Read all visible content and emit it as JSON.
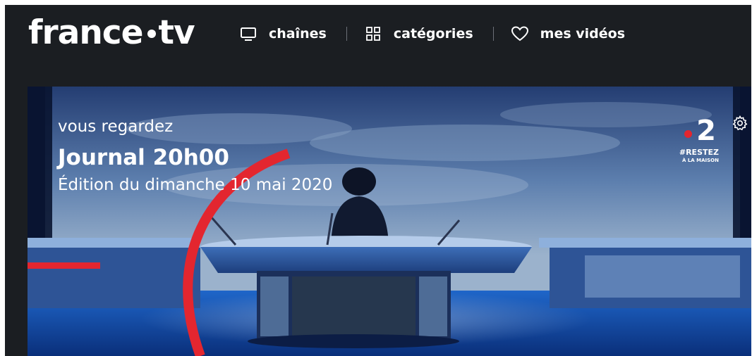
{
  "header": {
    "logo_left": "france",
    "logo_right": "tv",
    "nav": [
      {
        "label": "chaînes",
        "icon": "tv-icon"
      },
      {
        "label": "catégories",
        "icon": "grid-icon"
      },
      {
        "label": "mes vidéos",
        "icon": "heart-icon"
      }
    ]
  },
  "player": {
    "kicker": "vous regardez",
    "title": "Journal 20h00",
    "subtitle": "Édition du dimanche 10 mai 2020",
    "channel_number": "2",
    "channel_tag_line1": "#RESTEZ",
    "channel_tag_line2": "À LA MAISON",
    "settings_icon": "gear-icon"
  },
  "colors": {
    "header_bg": "#1b1e22",
    "accent_red": "#e3262f",
    "text": "#ffffff"
  }
}
